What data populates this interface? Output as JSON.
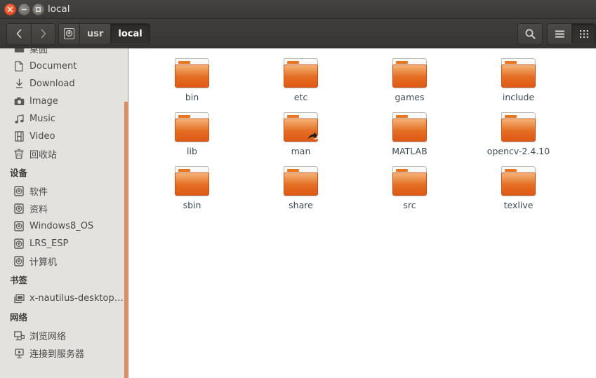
{
  "window": {
    "title": "local",
    "controls": {
      "close_label": "Close",
      "minimize_label": "Minimize",
      "maximize_label": "Maximize"
    }
  },
  "toolbar": {
    "back_label": "‹",
    "forward_label": "›",
    "breadcrumbs": [
      {
        "label": "",
        "icon": "drive-icon",
        "active": false
      },
      {
        "label": "usr",
        "icon": "",
        "active": false
      },
      {
        "label": "local",
        "icon": "",
        "active": true
      }
    ],
    "search_label": "search-icon",
    "list_view_label": "list-view-icon",
    "grid_view_label": "grid-view-icon",
    "active_view": "grid"
  },
  "sidebar": {
    "sections": [
      {
        "heading": "",
        "items": [
          {
            "label": "桌面",
            "icon": "folder-icon"
          },
          {
            "label": "Document",
            "icon": "document-icon"
          },
          {
            "label": "Download",
            "icon": "download-icon"
          },
          {
            "label": "Image",
            "icon": "camera-icon"
          },
          {
            "label": "Music",
            "icon": "music-note-icon"
          },
          {
            "label": "Video",
            "icon": "film-icon"
          },
          {
            "label": "回收站",
            "icon": "trash-icon"
          }
        ]
      },
      {
        "heading": "设备",
        "items": [
          {
            "label": "软件",
            "icon": "drive-icon"
          },
          {
            "label": "资料",
            "icon": "drive-icon"
          },
          {
            "label": "Windows8_OS",
            "icon": "drive-icon"
          },
          {
            "label": "LRS_ESP",
            "icon": "drive-icon"
          },
          {
            "label": "计算机",
            "icon": "drive-icon"
          }
        ]
      },
      {
        "heading": "书签",
        "items": [
          {
            "label": "x-nautilus-desktop…",
            "icon": "desktop-icon"
          }
        ]
      },
      {
        "heading": "网络",
        "items": [
          {
            "label": "浏览网络",
            "icon": "network-browse-icon"
          },
          {
            "label": "连接到服务器",
            "icon": "server-connect-icon"
          }
        ]
      }
    ]
  },
  "files": [
    {
      "name": "bin",
      "type": "folder",
      "symlink": false
    },
    {
      "name": "etc",
      "type": "folder",
      "symlink": false
    },
    {
      "name": "games",
      "type": "folder",
      "symlink": false
    },
    {
      "name": "include",
      "type": "folder",
      "symlink": false
    },
    {
      "name": "lib",
      "type": "folder",
      "symlink": false
    },
    {
      "name": "man",
      "type": "folder",
      "symlink": true
    },
    {
      "name": "MATLAB",
      "type": "folder",
      "symlink": false
    },
    {
      "name": "opencv-2.4.10",
      "type": "folder",
      "symlink": false
    },
    {
      "name": "sbin",
      "type": "folder",
      "symlink": false
    },
    {
      "name": "share",
      "type": "folder",
      "symlink": false
    },
    {
      "name": "src",
      "type": "folder",
      "symlink": false
    },
    {
      "name": "texlive",
      "type": "folder",
      "symlink": false
    }
  ],
  "colors": {
    "titlebar": "#3e3c3a",
    "close_button": "#e8542a",
    "sidebar_bg": "#e4e2df",
    "scrollbar_thumb": "#e08b5f",
    "folder_orange": "#e5762a",
    "label_text": "#3c4a57"
  }
}
